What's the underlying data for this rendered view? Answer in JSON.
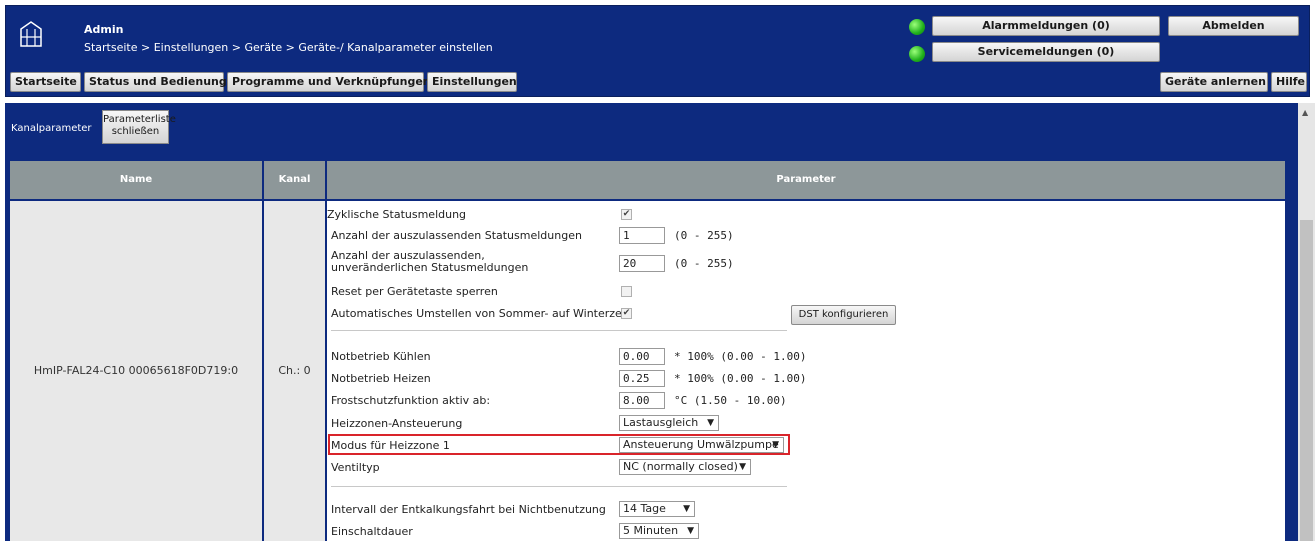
{
  "header": {
    "user": "Admin",
    "breadcrumb": "Startseite > Einstellungen > Geräte > Geräte-/ Kanalparameter einstellen",
    "alarm_button": "Alarmmeldungen (0)",
    "service_button": "Servicemeldungen (0)",
    "logout_button": "Abmelden",
    "nav": [
      "Startseite",
      "Status und Bedienung",
      "Programme und Verknüpfungen",
      "Einstellungen"
    ],
    "teach_button": "Geräte anlernen",
    "help_button": "Hilfe"
  },
  "subheader": {
    "label": "Kanalparameter",
    "close_list_line1": "Parameterliste",
    "close_list_line2": "schließen"
  },
  "table": {
    "headers": [
      "Name",
      "Kanal",
      "Parameter"
    ],
    "device_name": "HmIP-FAL24-C10 00065618F0D719:0",
    "channel": "Ch.: 0"
  },
  "params": {
    "cyclic_status": "Zyklische Statusmeldung",
    "skip_status": "Anzahl der auszulassenden Statusmeldungen",
    "skip_status_value": "1",
    "skip_status_range": "(0 - 255)",
    "skip_unchanged_line1": "Anzahl der auszulassenden,",
    "skip_unchanged_line2": "unveränderlichen Statusmeldungen",
    "skip_unchanged_value": "20",
    "skip_unchanged_range": "(0 - 255)",
    "reset_lock": "Reset per Gerätetaste sperren",
    "dst_auto": "Automatisches Umstellen von Sommer- auf Winterzeit",
    "dst_button": "DST konfigurieren",
    "emergency_cool": "Notbetrieb Kühlen",
    "emergency_cool_value": "0.00",
    "emergency_cool_range": "* 100% (0.00 - 1.00)",
    "emergency_heat": "Notbetrieb Heizen",
    "emergency_heat_value": "0.25",
    "emergency_heat_range": "* 100% (0.00 - 1.00)",
    "frost": "Frostschutzfunktion aktiv ab:",
    "frost_value": "8.00",
    "frost_range": "°C (1.50 - 10.00)",
    "zone_control": "Heizzonen-Ansteuerung",
    "zone_control_value": "Lastausgleich",
    "zone_mode": "Modus für Heizzone 1",
    "zone_mode_value": "Ansteuerung Umwälzpumpe",
    "valve_type": "Ventiltyp",
    "valve_type_value": "NC (normally closed)",
    "decalc_interval": "Intervall der Entkalkungsfahrt bei Nichtbenutzung",
    "decalc_interval_value": "14 Tage",
    "on_duration": "Einschaltdauer",
    "on_duration_value": "5 Minuten"
  },
  "colors": {
    "header_bg": "#0d2a7f",
    "table_header": "#8d9799",
    "highlight": "#d9242a",
    "led": "#1fb01b"
  }
}
